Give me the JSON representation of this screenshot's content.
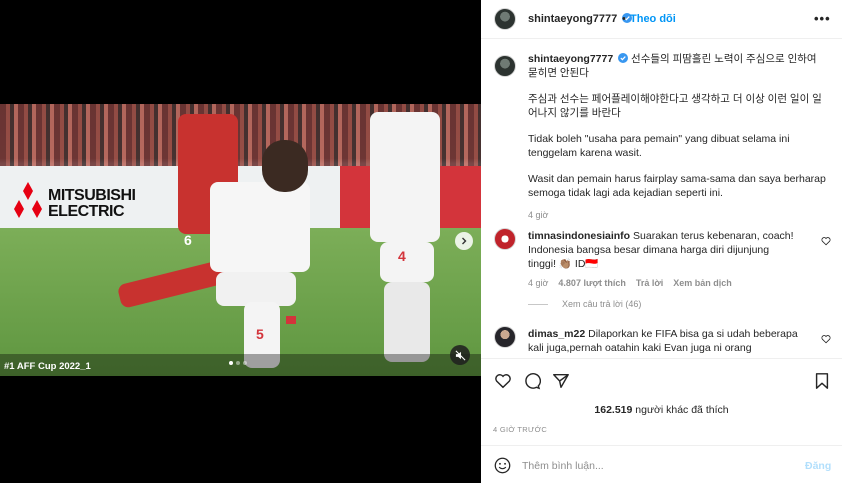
{
  "media": {
    "caption": "#1 AFF Cup 2022_1",
    "board_text_line1": "MITSUBISHI",
    "board_text_line2": "ELECTRIC",
    "jersey_numbers": [
      "6",
      "5",
      "4"
    ],
    "carousel_dots": 3,
    "active_dot": 0
  },
  "header": {
    "username": "shintaeyong7777",
    "separator": "•",
    "follow_label": "Theo dõi",
    "more_label": "•••"
  },
  "caption": {
    "username": "shintaeyong7777",
    "line1": "선수들의 피땀흘린 노력이 주심으로 인하여 묻히면 안된다",
    "para2": "주심과 선수는 페어플레이해야한다고 생각하고 더 이상 이런 일이 일어나지 않기를 바란다",
    "para3": "Tidak boleh \"usaha para pemain\" yang dibuat selama ini tenggelam karena wasit.",
    "para4": "Wasit dan pemain harus fairplay sama-sama dan saya berharap semoga tidak lagi ada kejadian seperti ini.",
    "time": "4 giờ"
  },
  "comments": [
    {
      "username": "timnasindonesiainfo",
      "text": "Suarakan terus kebenaran, coach! Indonesia bangsa besar dimana harga diri dijunjung tinggi! 👏🏽 ID🇮🇩",
      "time": "4 giờ",
      "likes": "4.807 lượt thích",
      "reply": "Trả lời",
      "translate": "Xem bản dịch",
      "view_replies": "Xem câu trả lời (46)"
    },
    {
      "username": "dimas_m22",
      "text": "Dilaporkan ke FIFA bisa ga si udah beberapa kali juga,pernah oatahin kaki Evan juga ni orang"
    }
  ],
  "actions": {
    "likes_count": "162.519",
    "likes_text": "người khác đã thích",
    "time_ago": "4 GIỜ TRƯỚC"
  },
  "add_comment": {
    "placeholder": "Thêm bình luận...",
    "post_label": "Đăng"
  },
  "colors": {
    "link_blue": "#0095f6",
    "post_disabled": "#b2dffc",
    "muted": "#8e8e8e",
    "verified": "#3897f0"
  }
}
